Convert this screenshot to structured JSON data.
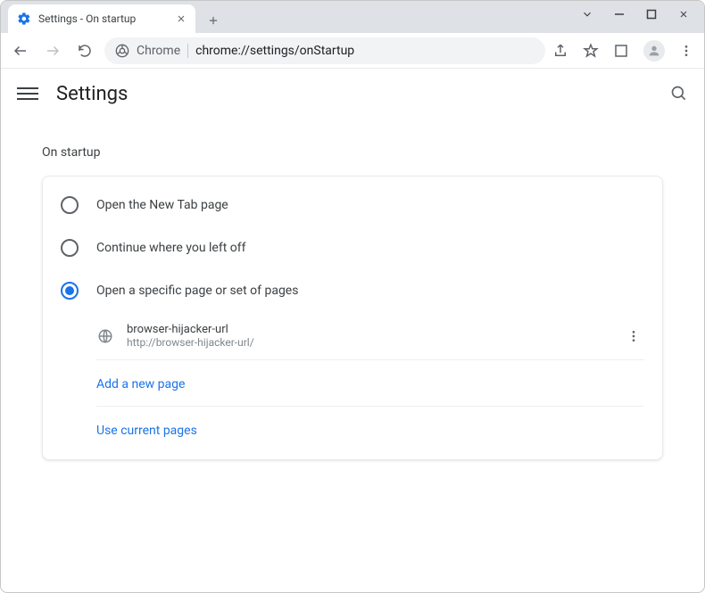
{
  "window": {
    "tab_title": "Settings - On startup"
  },
  "omnibox": {
    "chrome_label": "Chrome",
    "url": "chrome://settings/onStartup"
  },
  "header": {
    "title": "Settings"
  },
  "section": {
    "title": "On startup"
  },
  "radio": {
    "newtab": "Open the New Tab page",
    "continue": "Continue where you left off",
    "specific": "Open a specific page or set of pages"
  },
  "page_entry": {
    "title": "browser-hijacker-url",
    "url": "http://browser-hijacker-url/"
  },
  "actions": {
    "add_page": "Add a new page",
    "use_current": "Use current pages"
  }
}
